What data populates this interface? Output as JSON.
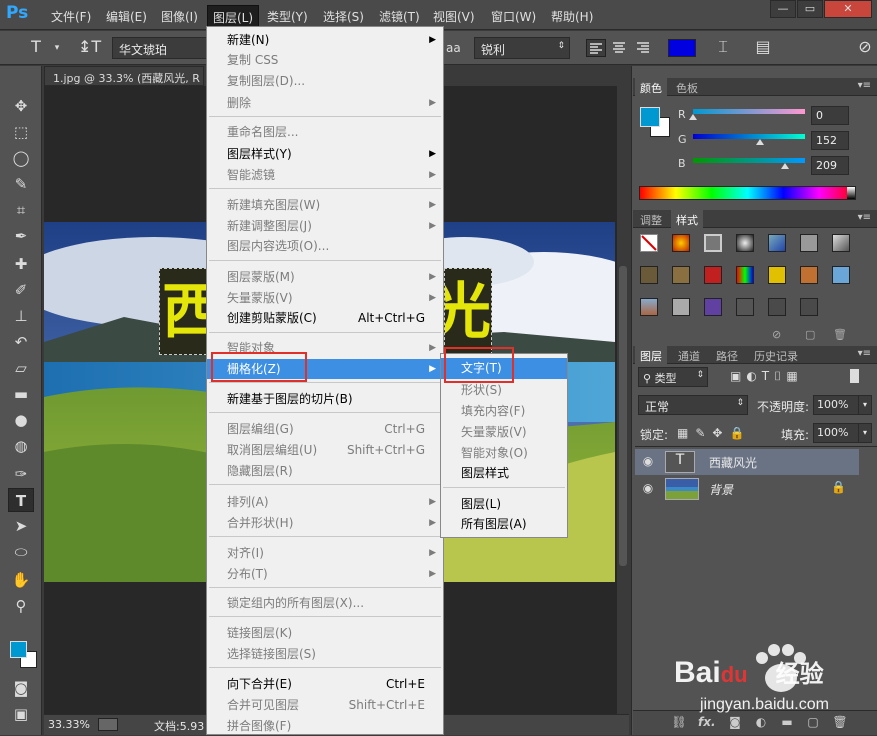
{
  "app": {
    "logo": "Ps"
  },
  "menubar": {
    "items": [
      "文件(F)",
      "编辑(E)",
      "图像(I)",
      "图层(L)",
      "类型(Y)",
      "选择(S)",
      "滤镜(T)",
      "视图(V)",
      "窗口(W)",
      "帮助(H)"
    ],
    "window_controls": [
      "—",
      "▭",
      "✕"
    ]
  },
  "options": {
    "font_family": "华文琥珀",
    "antialias": "锐利",
    "aa_label": "aa",
    "text_color": "#0000e0"
  },
  "document": {
    "tab_title": "1.jpg @ 33.3% (西藏风光, R",
    "overlay_text": "西藏风光",
    "zoom": "33.33%",
    "doc_info": "文档:5.93"
  },
  "layer_menu": {
    "items": [
      {
        "label": "新建(N)",
        "enabled": true,
        "submenu": true
      },
      {
        "label": "复制 CSS",
        "enabled": false
      },
      {
        "label": "复制图层(D)...",
        "enabled": false
      },
      {
        "label": "删除",
        "enabled": false,
        "submenu": true
      },
      {
        "label": "重命名图层...",
        "enabled": false
      },
      {
        "label": "图层样式(Y)",
        "enabled": true,
        "submenu": true
      },
      {
        "label": "智能滤镜",
        "enabled": false,
        "submenu": true
      },
      {
        "label": "新建填充图层(W)",
        "enabled": false,
        "submenu": true
      },
      {
        "label": "新建调整图层(J)",
        "enabled": false,
        "submenu": true
      },
      {
        "label": "图层内容选项(O)...",
        "enabled": false
      },
      {
        "label": "图层蒙版(M)",
        "enabled": false,
        "submenu": true
      },
      {
        "label": "矢量蒙版(V)",
        "enabled": false,
        "submenu": true
      },
      {
        "label": "创建剪贴蒙版(C)",
        "enabled": true,
        "shortcut": "Alt+Ctrl+G"
      },
      {
        "label": "智能对象",
        "enabled": false,
        "submenu": true
      },
      {
        "label": "栅格化(Z)",
        "enabled": true,
        "submenu": true,
        "highlighted": true
      },
      {
        "label": "新建基于图层的切片(B)",
        "enabled": true
      },
      {
        "label": "图层编组(G)",
        "enabled": false,
        "shortcut": "Ctrl+G"
      },
      {
        "label": "取消图层编组(U)",
        "enabled": false,
        "shortcut": "Shift+Ctrl+G"
      },
      {
        "label": "隐藏图层(R)",
        "enabled": false
      },
      {
        "label": "排列(A)",
        "enabled": false,
        "submenu": true
      },
      {
        "label": "合并形状(H)",
        "enabled": false,
        "submenu": true
      },
      {
        "label": "对齐(I)",
        "enabled": false,
        "submenu": true
      },
      {
        "label": "分布(T)",
        "enabled": false,
        "submenu": true
      },
      {
        "label": "锁定组内的所有图层(X)...",
        "enabled": false
      },
      {
        "label": "链接图层(K)",
        "enabled": false
      },
      {
        "label": "选择链接图层(S)",
        "enabled": false
      },
      {
        "label": "向下合并(E)",
        "enabled": true,
        "shortcut": "Ctrl+E"
      },
      {
        "label": "合并可见图层",
        "enabled": false,
        "shortcut": "Shift+Ctrl+E"
      },
      {
        "label": "拼合图像(F)",
        "enabled": false
      }
    ]
  },
  "rasterize_submenu": {
    "items": [
      {
        "label": "文字(T)",
        "enabled": true,
        "highlighted": true
      },
      {
        "label": "形状(S)",
        "enabled": false
      },
      {
        "label": "填充内容(F)",
        "enabled": false
      },
      {
        "label": "矢量蒙版(V)",
        "enabled": false
      },
      {
        "label": "智能对象(O)",
        "enabled": false
      },
      {
        "label": "图层样式",
        "enabled": true
      },
      {
        "label": "图层(L)",
        "enabled": true
      },
      {
        "label": "所有图层(A)",
        "enabled": true
      }
    ]
  },
  "color_panel": {
    "tabs": [
      "颜色",
      "色板"
    ],
    "r_label": "R",
    "g_label": "G",
    "b_label": "B",
    "r": "0",
    "g": "152",
    "b": "209",
    "r_fraction": 0.0,
    "g_fraction": 0.596,
    "b_fraction": 0.82,
    "fg_color": "#0098d1"
  },
  "adjust_panel": {
    "tabs": [
      "调整",
      "样式"
    ]
  },
  "layers_panel": {
    "tabs": [
      "图层",
      "通道",
      "路径",
      "历史记录"
    ],
    "filter_label": "类型",
    "blend_mode": "正常",
    "opacity_label": "不透明度:",
    "opacity": "100%",
    "lock_label": "锁定:",
    "fill_label": "填充:",
    "fill": "100%",
    "layers": [
      {
        "name": "西藏风光",
        "type": "text",
        "selected": true
      },
      {
        "name": "背景",
        "type": "image",
        "locked": true
      }
    ]
  },
  "watermark": {
    "brand": "Bai",
    "brand2": "du",
    "brand3": "经验",
    "url": "jingyan.baidu.com"
  }
}
